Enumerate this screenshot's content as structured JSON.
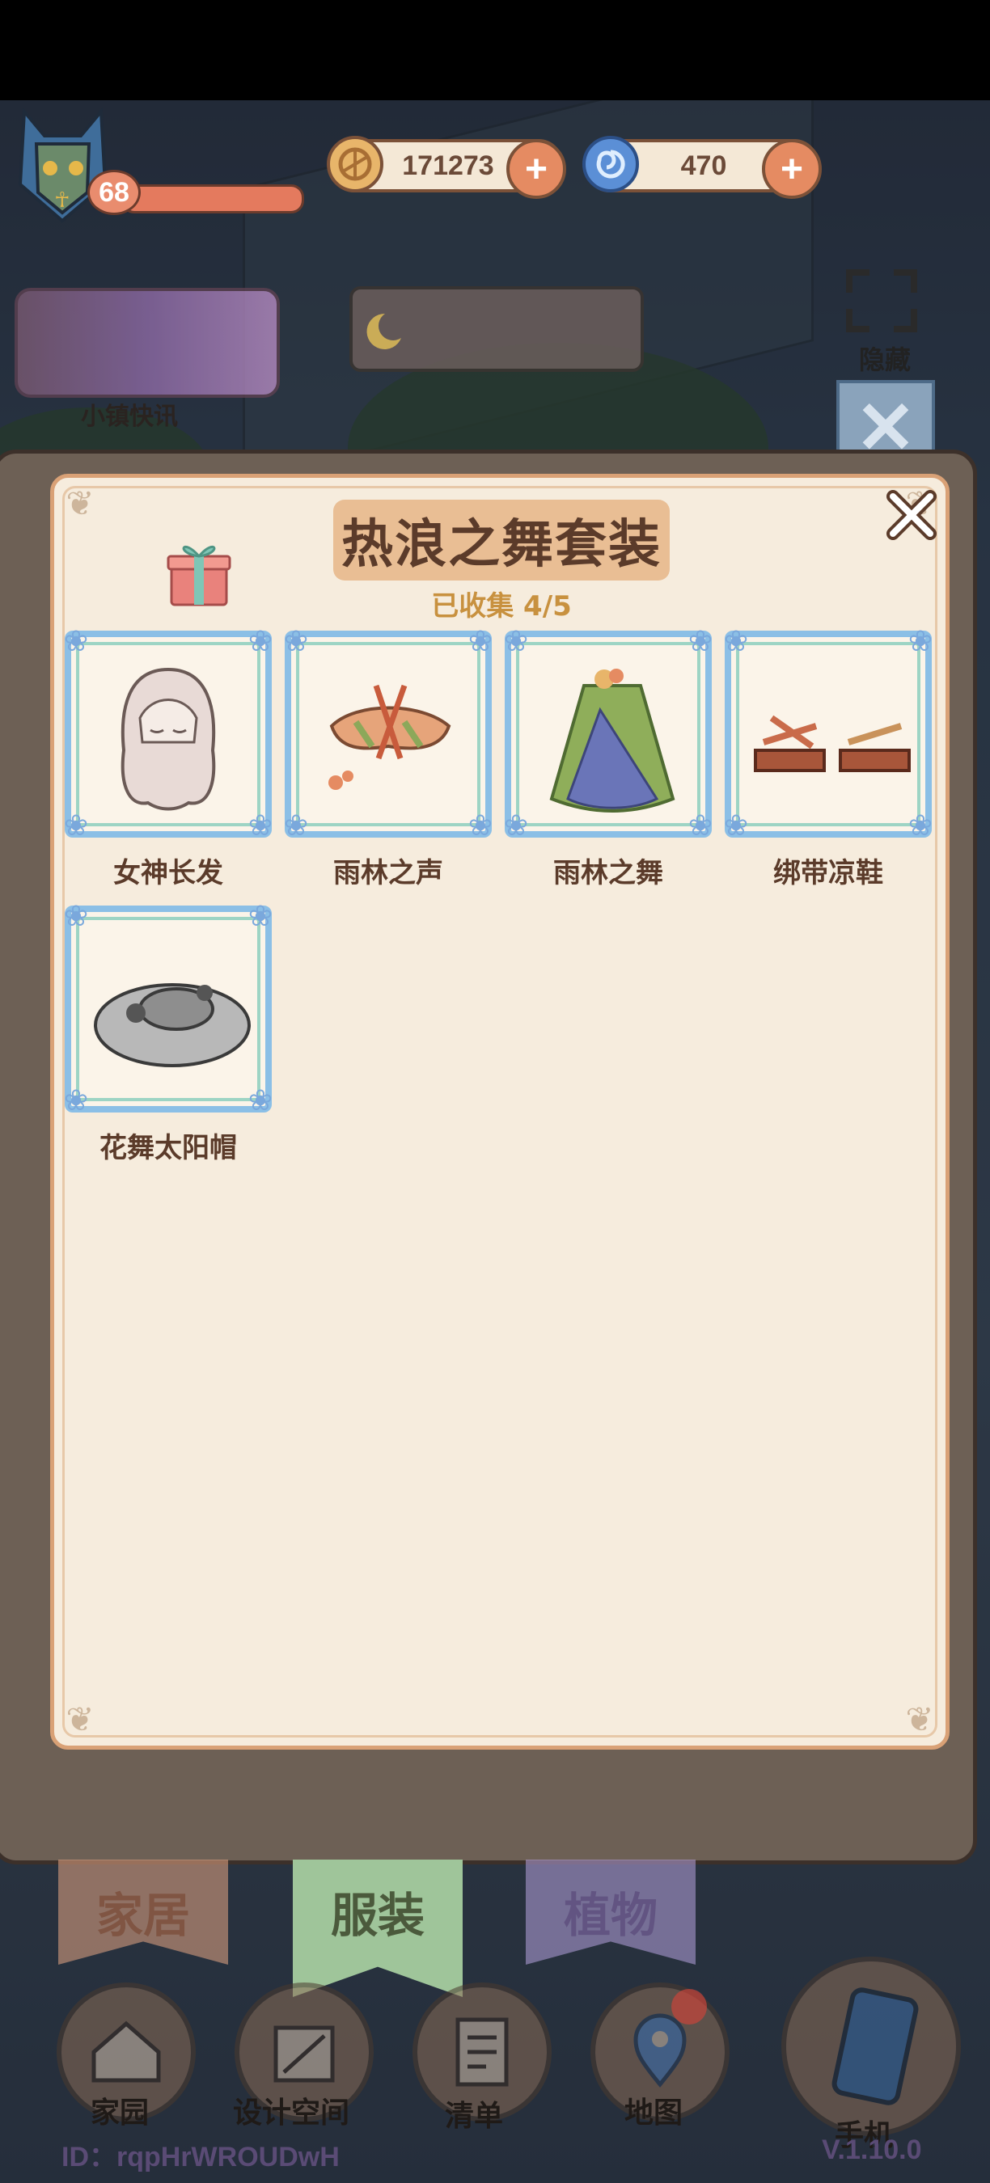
{
  "hud": {
    "level": "68",
    "xp_fraction": 1.0,
    "gold": "171273",
    "gems": "470",
    "add_label": "+"
  },
  "background": {
    "news_label": "小镇快讯",
    "hide_label": "隐藏",
    "close_glyph": "✕"
  },
  "panel": {
    "title": "热浪之舞套装",
    "collected": "已收集  4/5",
    "close_glyph": "✕",
    "items": [
      {
        "name": "女神长发",
        "icon": "hair-icon"
      },
      {
        "name": "雨林之声",
        "icon": "top-icon"
      },
      {
        "name": "雨林之舞",
        "icon": "skirt-icon"
      },
      {
        "name": "绑带凉鞋",
        "icon": "sandals-icon"
      },
      {
        "name": "花舞太阳帽",
        "icon": "sunhat-icon"
      }
    ]
  },
  "tabs": [
    {
      "label": "家居",
      "color": "#e6a584"
    },
    {
      "label": "服装",
      "color": "#9fc59a"
    },
    {
      "label": "植物",
      "color": "#b6a2de"
    }
  ],
  "nav": [
    {
      "label": "家园",
      "icon": "home-icon"
    },
    {
      "label": "设计空间",
      "icon": "design-icon"
    },
    {
      "label": "清单",
      "icon": "list-icon"
    },
    {
      "label": "地图",
      "icon": "map-icon"
    },
    {
      "label": "手机",
      "icon": "phone-icon"
    }
  ],
  "footer": {
    "user_id": "ID：rqpHrWROUDwH",
    "version": "V.1.10.0"
  },
  "colors": {
    "panel_bg": "#f6ecdd",
    "card_border": "#8bbfe6",
    "title_bg": "#e9be94",
    "accent": "#e58b62"
  }
}
